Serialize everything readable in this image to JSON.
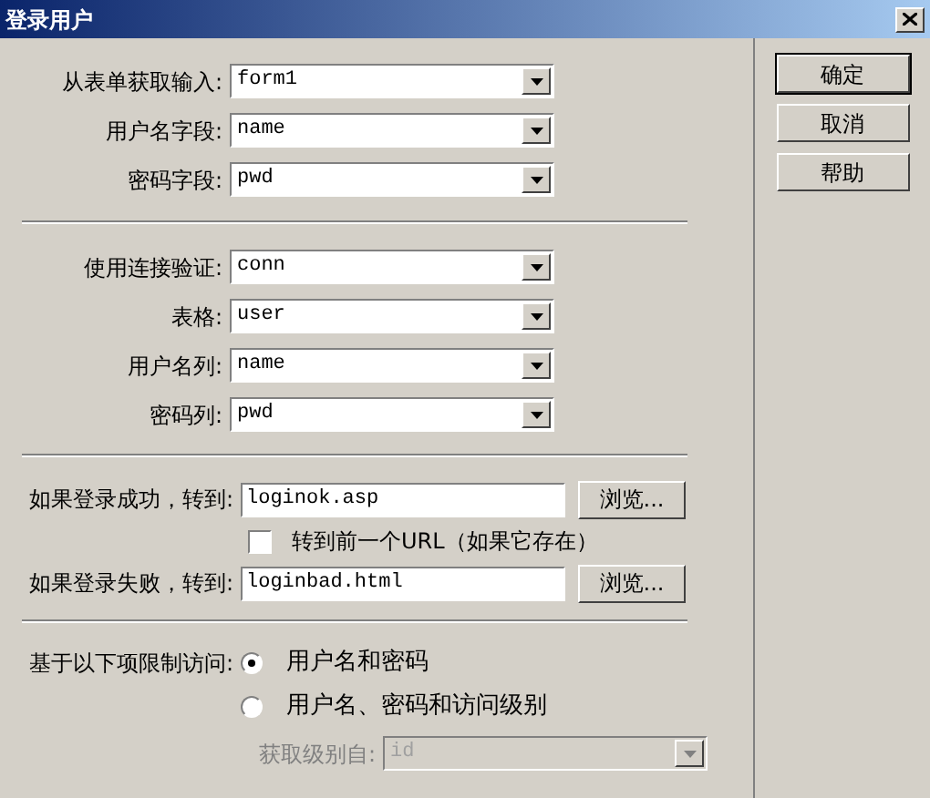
{
  "window": {
    "title": "登录用户"
  },
  "buttons": [
    {
      "label": "确定",
      "default": true
    },
    {
      "label": "取消",
      "default": false
    },
    {
      "label": "帮助",
      "default": false
    }
  ],
  "form_fields": [
    {
      "label": "从表单获取输入:",
      "value": "form1"
    },
    {
      "label": "用户名字段:",
      "value": "name"
    },
    {
      "label": "密码字段:",
      "value": "pwd"
    }
  ],
  "connection_fields": [
    {
      "label": "使用连接验证:",
      "value": "conn"
    },
    {
      "label": "表格:",
      "value": "user"
    },
    {
      "label": "用户名列:",
      "value": "name"
    },
    {
      "label": "密码列:",
      "value": "pwd"
    }
  ],
  "redirects": {
    "success": {
      "label": "如果登录成功，转到:",
      "value": "loginok.asp",
      "browse": "浏览..."
    },
    "previous_url": {
      "label": "转到前一个URL（如果它存在）",
      "checked": false
    },
    "failure": {
      "label": "如果登录失败，转到:",
      "value": "loginbad.html",
      "browse": "浏览..."
    }
  },
  "restrict": {
    "label": "基于以下项限制访问:",
    "options": [
      {
        "label": "用户名和密码",
        "selected": true
      },
      {
        "label": "用户名、密码和访问级别",
        "selected": false
      }
    ],
    "level_field": {
      "label": "获取级别自:",
      "value": "id",
      "disabled": true
    }
  }
}
